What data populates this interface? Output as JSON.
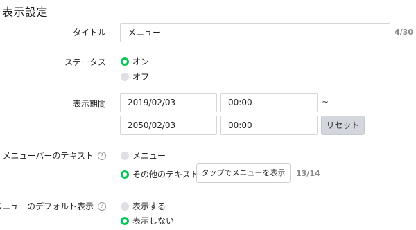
{
  "section": {
    "title": "表示設定"
  },
  "title_field": {
    "label": "タイトル",
    "value": "メニュー",
    "counter": "4/30"
  },
  "status": {
    "label": "ステータス",
    "options": [
      {
        "label": "オン",
        "selected": true
      },
      {
        "label": "オフ",
        "selected": false
      }
    ]
  },
  "period": {
    "label": "表示期間",
    "start_date": "2019/02/03",
    "start_time": "00:00",
    "separator": "~",
    "end_date": "2050/02/03",
    "end_time": "00:00",
    "reset_label": "リセット"
  },
  "menubar_text": {
    "label": "メニューバーのテキスト",
    "help_icon": "?",
    "options": [
      {
        "label": "メニュー",
        "selected": false
      },
      {
        "label": "その他のテキスト",
        "selected": true
      }
    ],
    "custom_text": "タップでメニューを表示",
    "counter": "13/14"
  },
  "default_display": {
    "label": "メニューのデフォルト表示",
    "help_icon": "?",
    "options": [
      {
        "label": "表示する",
        "selected": false
      },
      {
        "label": "表示しない",
        "selected": true
      }
    ]
  },
  "colors": {
    "accent": "#06c755",
    "radio_off": "#e0e0e4",
    "button_gray": "#d3d6dc"
  }
}
